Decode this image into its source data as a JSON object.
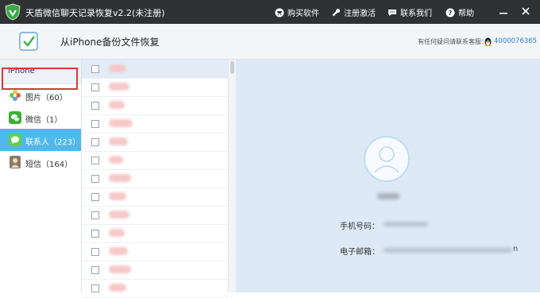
{
  "titlebar": {
    "app_title": "天盾微信聊天记录恢复v2.2(未注册)",
    "menu": [
      {
        "label": "购买软件",
        "icon": "shopping-cart-icon"
      },
      {
        "label": "注册激活",
        "icon": "wrench-icon"
      },
      {
        "label": "联系我们",
        "icon": "chat-bubble-icon"
      },
      {
        "label": "帮助",
        "icon": "help-icon"
      }
    ],
    "window_buttons": [
      "minimize-icon",
      "close-icon"
    ]
  },
  "header": {
    "page_title": "从iPhone备份文件恢复",
    "support_label": "有任何疑问请联系客服：",
    "support_number": "4000076365"
  },
  "sidebar": {
    "device": "iPhone",
    "items": [
      {
        "label": "图片（60）",
        "icon": "photos-icon",
        "color": "#f2a33a",
        "active": false
      },
      {
        "label": "微信（1）",
        "icon": "wechat-icon",
        "color": "#3cb034",
        "active": false
      },
      {
        "label": "联系人（223）",
        "icon": "contacts-icon",
        "color": "#5fcf4f",
        "active": true
      },
      {
        "label": "短信（164）",
        "icon": "messages-icon",
        "color": "#8a7a6a",
        "active": false
      }
    ]
  },
  "detail": {
    "phone_label": "手机号码：",
    "email_label": "电子邮箱：",
    "email_tail": "n"
  },
  "colors": {
    "titlebar": "#2f3133",
    "accent": "#4fb8ef",
    "selection_outline": "#d33a3a",
    "detail_bg": "#ddeaf6"
  }
}
